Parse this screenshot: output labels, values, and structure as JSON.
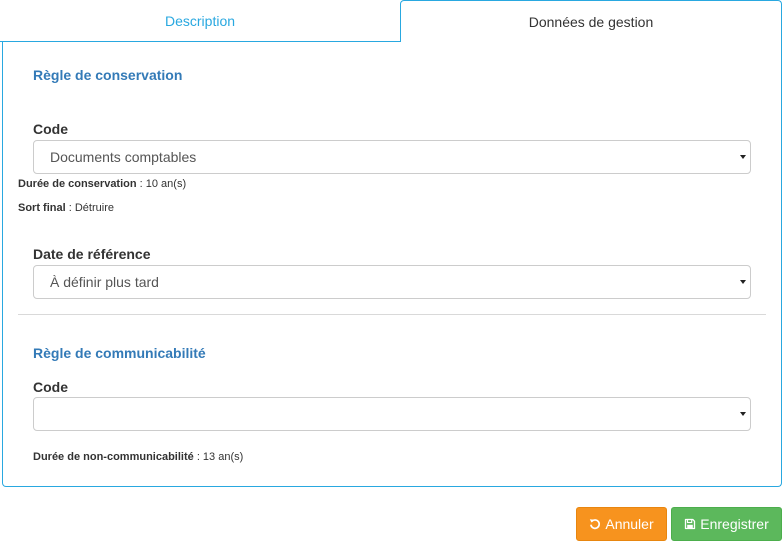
{
  "tabs": [
    {
      "label": "Description",
      "active": false
    },
    {
      "label": "Données de gestion",
      "active": true
    }
  ],
  "conservation": {
    "title": "Règle de conservation",
    "code_label": "Code",
    "code_value": "Documents comptables",
    "duree_label": "Durée de conservation",
    "duree_value": ": 10 an(s)",
    "sort_label": "Sort final",
    "sort_value": ": Détruire",
    "date_label": "Date de référence",
    "date_value": "À définir plus tard"
  },
  "communicabilite": {
    "title": "Règle de communicabilité",
    "code_label": "Code",
    "code_value": "",
    "duree_label": "Durée de non-communicabilité",
    "duree_value": ": 13 an(s)"
  },
  "buttons": {
    "cancel_label": "Annuler",
    "save_label": "Enregistrer",
    "cancel_icon": "undo-icon",
    "save_icon": "floppy-disk-icon"
  },
  "colors": {
    "accent": "#29a8e0",
    "section_title": "#337ab7",
    "cancel": "#f7931e",
    "save": "#5cb85c"
  }
}
